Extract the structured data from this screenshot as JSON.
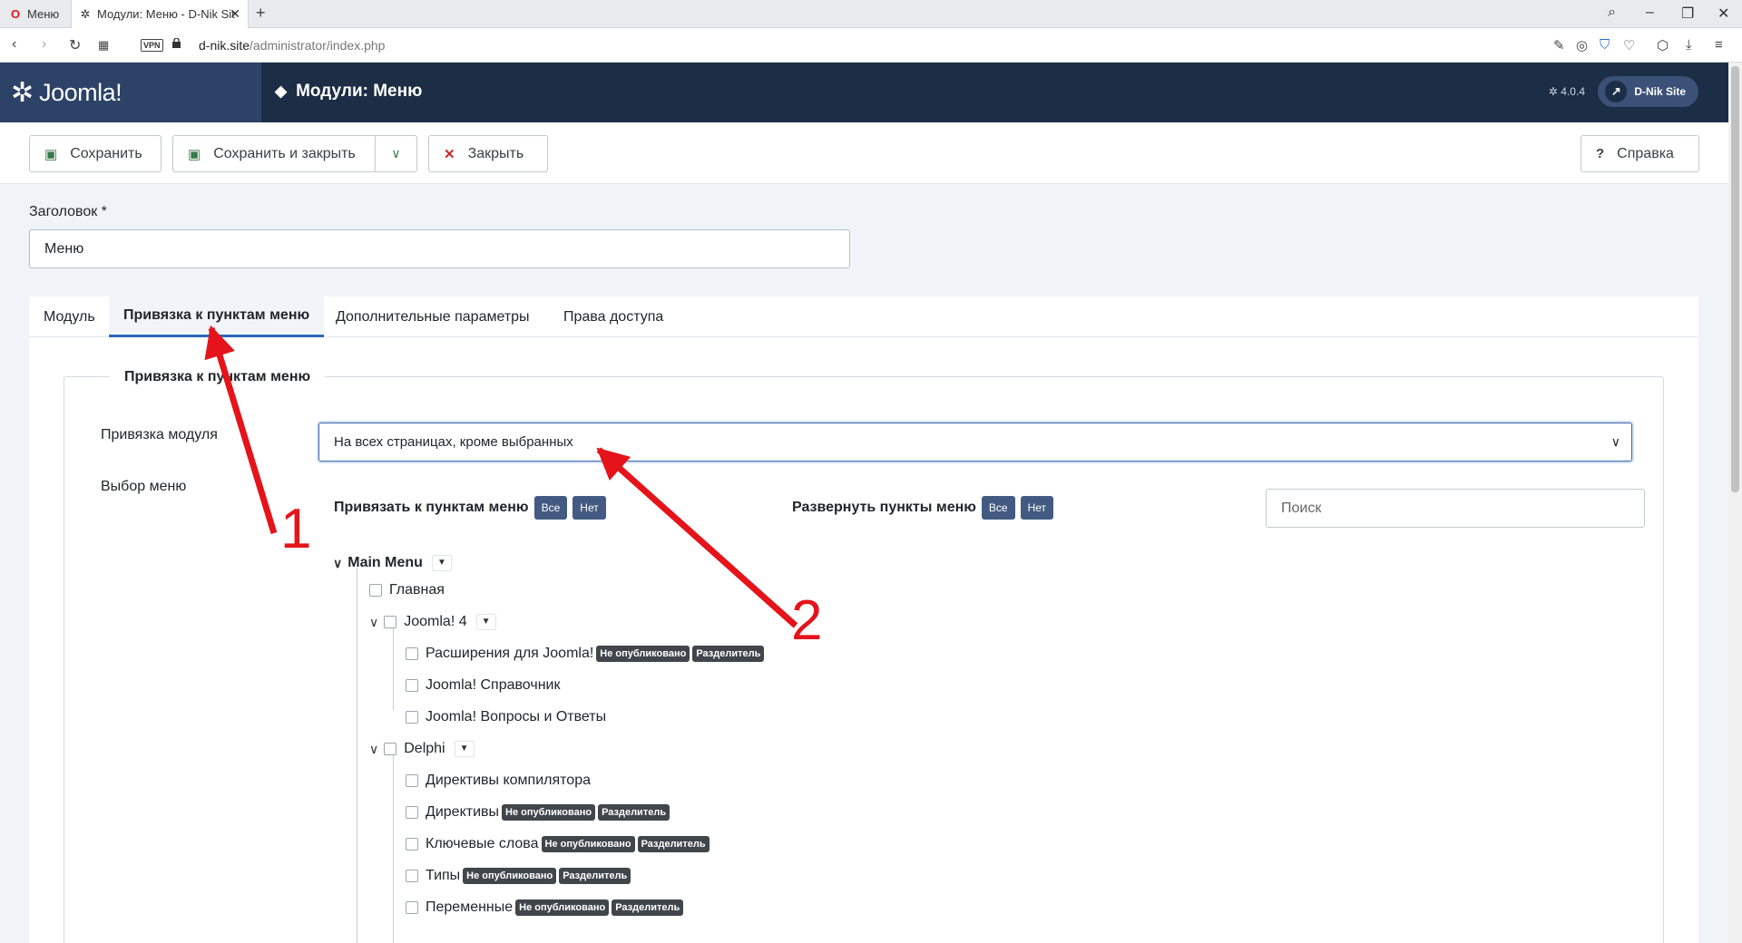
{
  "browser": {
    "tabs": [
      {
        "label": "Меню",
        "icon": "opera-icon"
      },
      {
        "label": "Модули: Меню - D-Nik Sit",
        "icon": "joomla-icon"
      }
    ],
    "url_host": "d-nik.site",
    "url_path": "/administrator/index.php",
    "vpn_label": "VPN"
  },
  "header": {
    "brand": "Joomla!",
    "title": "Модули: Меню",
    "version": "4.0.4",
    "site_button": "D-Nik Site"
  },
  "toolbar": {
    "save": "Сохранить",
    "save_close": "Сохранить и закрыть",
    "close": "Закрыть",
    "help": "Справка"
  },
  "form": {
    "title_label": "Заголовок *",
    "title_value": "Меню"
  },
  "tabs": [
    "Модуль",
    "Привязка к пунктам меню",
    "Дополнительные параметры",
    "Права доступа"
  ],
  "assignment": {
    "legend": "Привязка к пунктам меню",
    "module_label": "Привязка модуля",
    "module_value": "На всех страницах, кроме выбранных",
    "menu_label": "Выбор меню",
    "assign_label": "Привязать к пунктам меню",
    "expand_label": "Развернуть пункты меню",
    "all": "Все",
    "none": "Нет",
    "search_placeholder": "Поиск"
  },
  "tree": {
    "root": "Main Menu",
    "home": "Главная",
    "joomla": "Joomla! 4",
    "joomla_children": [
      "Расширения для Joomla!",
      "Joomla! Справочник",
      "Joomla! Вопросы и Ответы"
    ],
    "delphi": "Delphi",
    "delphi_children": [
      "Директивы компилятора",
      "Директивы",
      "Ключевые слова",
      "Типы",
      "Переменные"
    ],
    "badge_unpublished": "Не опубликовано",
    "badge_separator": "Разделитель"
  },
  "annotations": [
    "1",
    "2"
  ],
  "colors": {
    "header_bg": "#1c2d46",
    "logo_bg": "#2c4266",
    "pill": "#435b82",
    "arrow": "#e4141a",
    "active_tab": "#2a69b8"
  }
}
